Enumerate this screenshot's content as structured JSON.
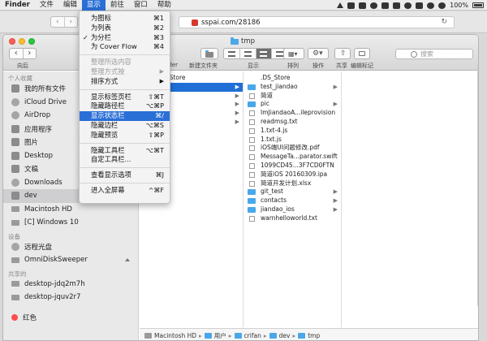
{
  "menubar": {
    "app": "Finder",
    "items": [
      "文件",
      "编辑",
      "显示",
      "前往",
      "窗口",
      "帮助"
    ],
    "active_index": 2,
    "battery": "100%"
  },
  "browser": {
    "url": "sspai.com/28186"
  },
  "window": {
    "title": "tmp",
    "back_label": "向后",
    "finder_label": "nder",
    "new_folder_label": "新建文件夹",
    "view_label": "显示",
    "arrange_label": "排列",
    "action_label": "操作",
    "share_label": "共享",
    "tags_label": "编辑标记",
    "search_placeholder": "搜索"
  },
  "view_menu": {
    "items": [
      {
        "label": "为图标",
        "shortcut": "⌘1"
      },
      {
        "label": "为列表",
        "shortcut": "⌘2"
      },
      {
        "label": "为分栏",
        "shortcut": "⌘3",
        "checked": "✓"
      },
      {
        "label": "为 Cover Flow",
        "shortcut": "⌘4"
      },
      {
        "sep": true
      },
      {
        "label": "整理所选内容",
        "disabled": true
      },
      {
        "label": "整理方式按",
        "disabled": true,
        "arrow": "▶"
      },
      {
        "label": "排序方式",
        "arrow": "▶"
      },
      {
        "sep": true
      },
      {
        "label": "显示标签页栏",
        "shortcut": "⇧⌘T"
      },
      {
        "label": "隐藏路径栏",
        "shortcut": "⌥⌘P"
      },
      {
        "label": "显示状态栏",
        "shortcut": "⌘/",
        "highlighted": true
      },
      {
        "label": "隐藏边栏",
        "shortcut": "⌥⌘S"
      },
      {
        "label": "隐藏预览",
        "shortcut": "⇧⌘P"
      },
      {
        "sep": true
      },
      {
        "label": "隐藏工具栏",
        "shortcut": "⌥⌘T"
      },
      {
        "label": "自定工具栏..."
      },
      {
        "sep": true
      },
      {
        "label": "查看显示选项",
        "shortcut": "⌘J"
      },
      {
        "sep": true
      },
      {
        "label": "进入全屏幕",
        "shortcut": "^⌘F"
      }
    ]
  },
  "sidebar": {
    "sections": [
      {
        "title": "个人收藏",
        "items": [
          {
            "label": "我的所有文件",
            "icon": "all-files-icon"
          },
          {
            "label": "iCloud Drive",
            "icon": "cloud-icon"
          },
          {
            "label": "AirDrop",
            "icon": "airdrop-icon"
          },
          {
            "label": "应用程序",
            "icon": "applications-icon"
          },
          {
            "label": "图片",
            "icon": "pictures-icon"
          },
          {
            "label": "Desktop",
            "icon": "desktop-icon"
          },
          {
            "label": "文稿",
            "icon": "documents-icon"
          },
          {
            "label": "Downloads",
            "icon": "downloads-icon"
          },
          {
            "label": "dev",
            "icon": "folder-icon",
            "selected": true
          },
          {
            "label": "Macintosh HD",
            "icon": "hard-disk-icon"
          },
          {
            "label": "[C] Windows 10",
            "icon": "windows-disk-icon"
          }
        ]
      },
      {
        "title": "设备",
        "items": [
          {
            "label": "远程光盘",
            "icon": "remote-disc-icon"
          },
          {
            "label": "OmniDiskSweeper",
            "icon": "disk-image-icon",
            "eject": true
          }
        ]
      },
      {
        "title": "共享的",
        "items": [
          {
            "label": "desktop-jdq2m7h",
            "icon": "network-pc-icon"
          },
          {
            "label": "desktop-jquv2r7",
            "icon": "network-pc-icon"
          }
        ]
      },
      {
        "title": "",
        "items": [
          {
            "label": "红色",
            "icon": "red-tag-icon"
          }
        ]
      }
    ]
  },
  "columns": {
    "col1": [
      {
        "label": ".DS_Store",
        "kind": "none"
      },
      {
        "label": "",
        "kind": "folder",
        "selected": true,
        "chev": "▶"
      },
      {
        "label": "ool",
        "kind": "folder",
        "chev": "▶"
      },
      {
        "label": "ool",
        "kind": "folder",
        "chev": "▶"
      },
      {
        "label": "oc",
        "kind": "folder",
        "chev": "▶"
      },
      {
        "label": "rc",
        "kind": "folder",
        "chev": "▶"
      }
    ],
    "col2": [
      {
        "label": ".DS_Store",
        "kind": "none"
      },
      {
        "label": "test_jiandao",
        "kind": "folder",
        "chev": "▶"
      },
      {
        "label": "简道",
        "kind": "file"
      },
      {
        "label": "pic",
        "kind": "folder",
        "chev": "▶"
      },
      {
        "label": "ImJiandaoA...ileprovision",
        "kind": "file"
      },
      {
        "label": "readmsg.txt",
        "kind": "file"
      },
      {
        "label": "1.txt-4.js",
        "kind": "file"
      },
      {
        "label": "1.txt.js",
        "kind": "file"
      },
      {
        "label": "iOS端UI问题修改.pdf",
        "kind": "file"
      },
      {
        "label": "MessageTa...parator.swift",
        "kind": "file"
      },
      {
        "label": "1099CD45...3F7CD0FTN",
        "kind": "file"
      },
      {
        "label": "简道iOS 20160309.ipa",
        "kind": "file"
      },
      {
        "label": "简道开发计划.xlsx",
        "kind": "file"
      },
      {
        "label": "git_test",
        "kind": "folder",
        "chev": "▶"
      },
      {
        "label": "contacts",
        "kind": "folder",
        "chev": "▶"
      },
      {
        "label": "jiandao_ios",
        "kind": "folder",
        "chev": "▶"
      },
      {
        "label": "warnhelloworld.txt",
        "kind": "file"
      }
    ]
  },
  "pathbar": [
    "Macintosh HD",
    "用户",
    "crifan",
    "dev",
    "tmp"
  ]
}
